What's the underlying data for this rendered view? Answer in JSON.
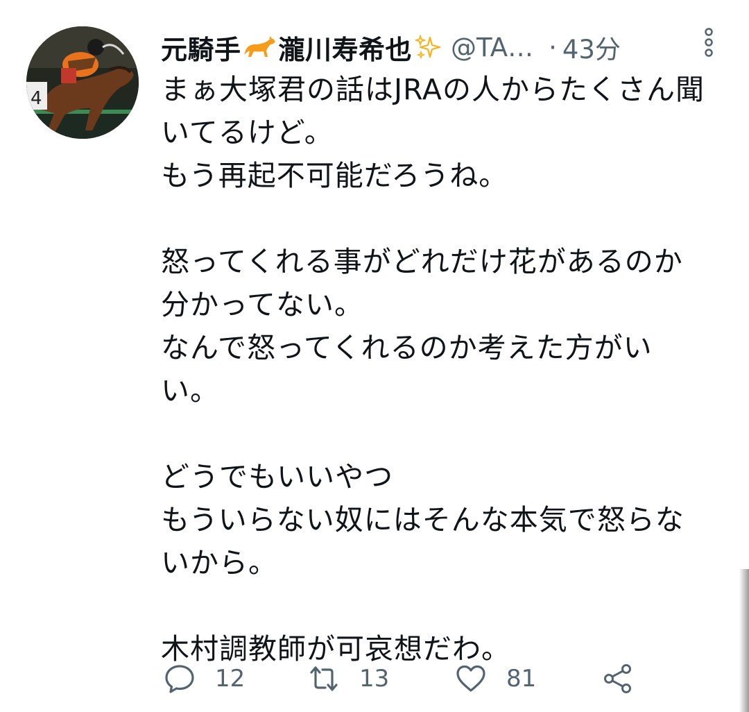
{
  "tweet": {
    "author_name_prefix": "元騎手",
    "author_name_suffix": "瀧川寿希也",
    "handle": "@TA…",
    "separator": "·",
    "time": "43分",
    "text": "まぁ大塚君の話はJRAの人からたくさん聞\nいてるけど。\nもう再起不可能だろうね。\n\n怒ってくれる事がどれだけ花があるのか\n分かってない。\nなんで怒ってくれるのか考えた方がい\nい。\n\nどうでもいいやつ\nもういらない奴にはそんな本気で怒らな\nいから。\n\n木村調教師が可哀想だわ。",
    "replies": "12",
    "retweets": "13",
    "likes": "81"
  },
  "icons": {
    "horse": "horse-emoji-icon",
    "sparkle": "sparkles-emoji-icon",
    "more": "more-vertical-icon",
    "reply": "reply-icon",
    "retweet": "retweet-icon",
    "like": "heart-icon",
    "share": "share-icon"
  },
  "colors": {
    "text": "#0f1419",
    "secondary": "#536471",
    "horse": "#f59c1a",
    "sparkle": "#f7b21a"
  }
}
